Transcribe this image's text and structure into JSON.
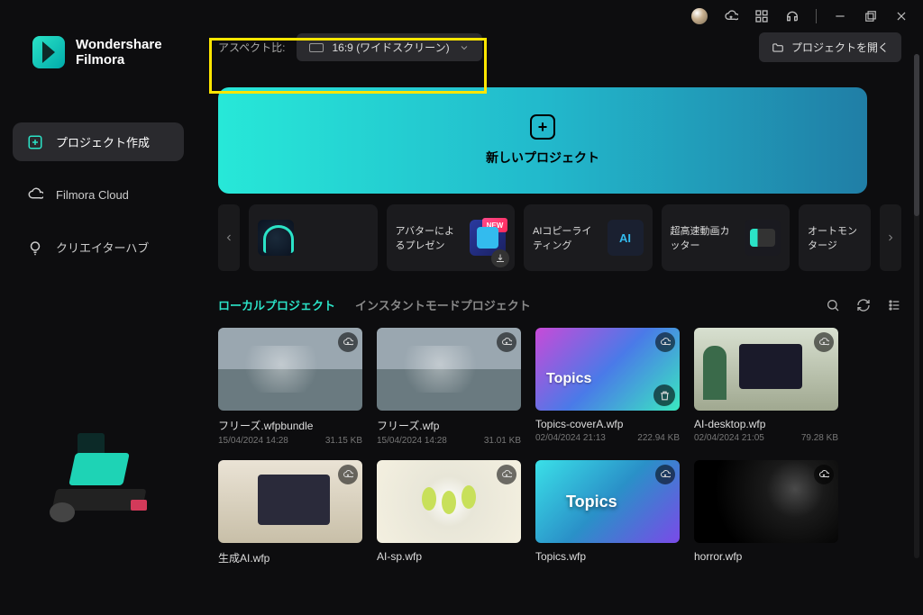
{
  "brand": {
    "line1": "Wondershare",
    "line2": "Filmora"
  },
  "sidebar": {
    "items": [
      {
        "label": "プロジェクト作成",
        "icon": "plus-square-icon"
      },
      {
        "label": "Filmora Cloud",
        "icon": "cloud-icon"
      },
      {
        "label": "クリエイターハブ",
        "icon": "lightbulb-icon"
      }
    ]
  },
  "aspect": {
    "label": "アスペクト比:",
    "value": "16:9 (ワイドスクリーン)"
  },
  "open_project": "プロジェクトを開く",
  "new_project": "新しいプロジェクト",
  "features": [
    {
      "label": ""
    },
    {
      "label": "アバターによるプレゼン",
      "badge": "NEW"
    },
    {
      "label": "AIコピーライティング"
    },
    {
      "label": "超高速動画カッター"
    },
    {
      "label": "オートモンタージ"
    }
  ],
  "tabs": {
    "local": "ローカルプロジェクト",
    "instant": "インスタントモードプロジェクト"
  },
  "projects": [
    {
      "name": "フリーズ.wfpbundle",
      "date": "15/04/2024 14:28",
      "size": "31.15 KB"
    },
    {
      "name": "フリーズ.wfp",
      "date": "15/04/2024 14:28",
      "size": "31.01 KB"
    },
    {
      "name": "Topics-coverA.wfp",
      "date": "02/04/2024 21:13",
      "size": "222.94 KB"
    },
    {
      "name": "AI-desktop.wfp",
      "date": "02/04/2024 21:05",
      "size": "79.28 KB"
    },
    {
      "name": "生成AI.wfp",
      "date": "",
      "size": ""
    },
    {
      "name": "AI-sp.wfp",
      "date": "",
      "size": ""
    },
    {
      "name": "Topics.wfp",
      "date": "",
      "size": ""
    },
    {
      "name": "horror.wfp",
      "date": "",
      "size": ""
    }
  ]
}
